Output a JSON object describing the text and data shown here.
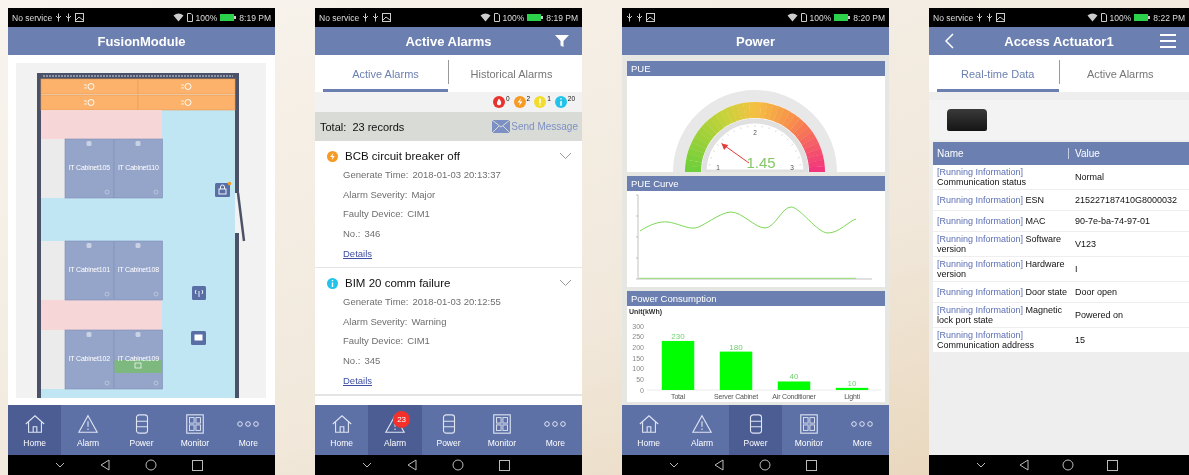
{
  "screens": [
    {
      "kind": "floor_plan",
      "status_bar": {
        "carrier": "No service",
        "battery": "100%",
        "time": "8:19 PM"
      },
      "header": {
        "title": "FusionModule"
      },
      "floor_plan": {
        "cabinet_rows": [
          [
            {
              "label": "IT Cabinet105",
              "highlighted": false
            },
            {
              "label": "IT Cabinet110",
              "highlighted": false
            }
          ],
          [
            {
              "label": "IT Cabinet101",
              "highlighted": false
            },
            {
              "label": "IT Cabinet108",
              "highlighted": false
            }
          ],
          [
            {
              "label": "IT Cabinet102",
              "highlighted": false
            },
            {
              "label": "IT Cabinet109",
              "highlighted": true
            }
          ]
        ]
      },
      "nav": [
        {
          "label": "Home",
          "selected": true
        },
        {
          "label": "Alarm",
          "selected": false
        },
        {
          "label": "Power",
          "selected": false
        },
        {
          "label": "Monitor",
          "selected": false
        },
        {
          "label": "More",
          "selected": false
        }
      ]
    },
    {
      "kind": "alarm_list",
      "status_bar": {
        "carrier": "No service",
        "battery": "100%",
        "time": "8:19 PM"
      },
      "header": {
        "title": "Active Alarms"
      },
      "tabs": [
        {
          "label": "Active Alarms",
          "selected": true
        },
        {
          "label": "Historical Alarms",
          "selected": false
        }
      ],
      "severity_counts": [
        {
          "kind": "critical",
          "color": "#e8322d",
          "count": "0"
        },
        {
          "kind": "major",
          "color": "#f59a23",
          "count": "2"
        },
        {
          "kind": "minor",
          "color": "#f2dc2c",
          "count": "1"
        },
        {
          "kind": "warning",
          "color": "#22c3ea",
          "count": "20"
        }
      ],
      "total": "Total:  23 records",
      "send_message": "Send Message",
      "alarms": [
        {
          "kind": "major",
          "color": "#f59a23",
          "title": "BCB circuit breaker off",
          "fields": [
            {
              "label": "Generate Time:",
              "value": "2018-01-03 20:13:37"
            },
            {
              "label": "Alarm Severity:",
              "value": "Major"
            },
            {
              "label": "Faulty Device:",
              "value": "CIM1"
            },
            {
              "label": "No.:",
              "value": "346"
            }
          ],
          "details": "Details"
        },
        {
          "kind": "warning",
          "color": "#22c3ea",
          "title": "BIM 20 comm failure",
          "fields": [
            {
              "label": "Generate Time:",
              "value": "2018-01-03 20:12:55"
            },
            {
              "label": "Alarm Severity:",
              "value": "Warning"
            },
            {
              "label": "Faulty Device:",
              "value": "CIM1"
            },
            {
              "label": "No.:",
              "value": "345"
            }
          ],
          "details": "Details"
        }
      ],
      "nav": [
        {
          "label": "Home",
          "selected": false
        },
        {
          "label": "Alarm",
          "selected": true,
          "badge": "23"
        },
        {
          "label": "Power",
          "selected": false
        },
        {
          "label": "Monitor",
          "selected": false
        },
        {
          "label": "More",
          "selected": false
        }
      ]
    },
    {
      "kind": "power",
      "status_bar": {
        "battery": "100%",
        "time": "8:20 PM"
      },
      "header": {
        "title": "Power"
      },
      "sections": [
        {
          "kind": "gauge",
          "title": "PUE",
          "value": "1.45",
          "ticks": [
            "1",
            "2",
            "3"
          ]
        },
        {
          "kind": "curve",
          "title": "PUE Curve"
        },
        {
          "kind": "bar_chart",
          "title": "Power Consumption",
          "chart_data": {
            "type": "bar",
            "ylabel": "Unit(kWh)",
            "categories": [
              "Total",
              "Server Cabinet",
              "Air Conditioner",
              "Lighti"
            ],
            "values": [
              230,
              180,
              40,
              10
            ],
            "ylim": [
              0,
              300
            ],
            "yticks": [
              0,
              50,
              100,
              150,
              200,
              250,
              300
            ],
            "data_labels": true
          }
        }
      ],
      "nav": [
        {
          "label": "Home",
          "selected": false
        },
        {
          "label": "Alarm",
          "selected": false
        },
        {
          "label": "Power",
          "selected": true
        },
        {
          "label": "Monitor",
          "selected": false
        },
        {
          "label": "More",
          "selected": false
        }
      ]
    },
    {
      "kind": "device_detail",
      "status_bar": {
        "carrier": "No service",
        "battery": "100%",
        "time": "8:22 PM"
      },
      "header": {
        "title": "Access Actuator1"
      },
      "tabs": [
        {
          "label": "Real-time Data",
          "selected": true
        },
        {
          "label": "Active Alarms",
          "selected": false
        }
      ],
      "table": {
        "columns": [
          "Name",
          "Value"
        ],
        "rows": [
          {
            "group": "[Running Information]",
            "name": "Communication status",
            "value": "Normal"
          },
          {
            "group": "[Running Information]",
            "name": "ESN",
            "value": "215227187410G8000032"
          },
          {
            "group": "[Running Information]",
            "name": "MAC",
            "value": "90-7e-ba-74-97-01"
          },
          {
            "group": "[Running Information]",
            "name": "Software version",
            "value": "V123"
          },
          {
            "group": "[Running Information]",
            "name": "Hardware version",
            "value": "I"
          },
          {
            "group": "[Running Information]",
            "name": "Door state",
            "value": "Door open"
          },
          {
            "group": "[Running Information]",
            "name": "Magnetic lock port state",
            "value": "Powered on"
          },
          {
            "group": "[Running Information]",
            "name": "Communication address",
            "value": "15"
          }
        ]
      }
    }
  ]
}
